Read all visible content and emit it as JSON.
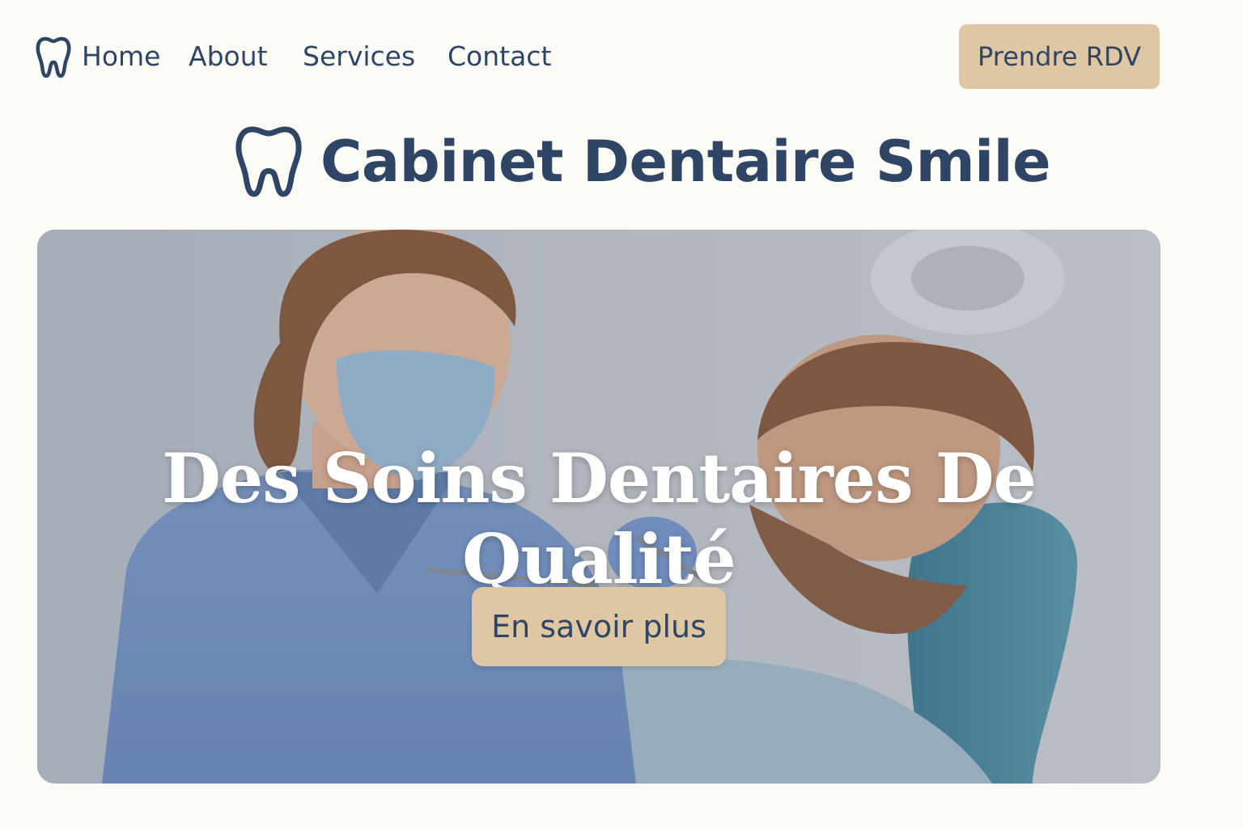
{
  "nav": {
    "logo_icon": "tooth-icon",
    "links": [
      "Home",
      "About",
      "Services",
      "Contact"
    ],
    "cta_label": "Prendre RDV"
  },
  "brand": {
    "icon": "tooth-icon",
    "title": "Cabinet Dentaire Smile"
  },
  "hero": {
    "image": "dentist-treating-patient-photo",
    "headline": "Des Soins Dentaires De Qualité",
    "button_label": "En savoir plus"
  },
  "colors": {
    "background": "#fdfbf5",
    "text": "#2f4566",
    "accent": "#dfc7a3"
  }
}
